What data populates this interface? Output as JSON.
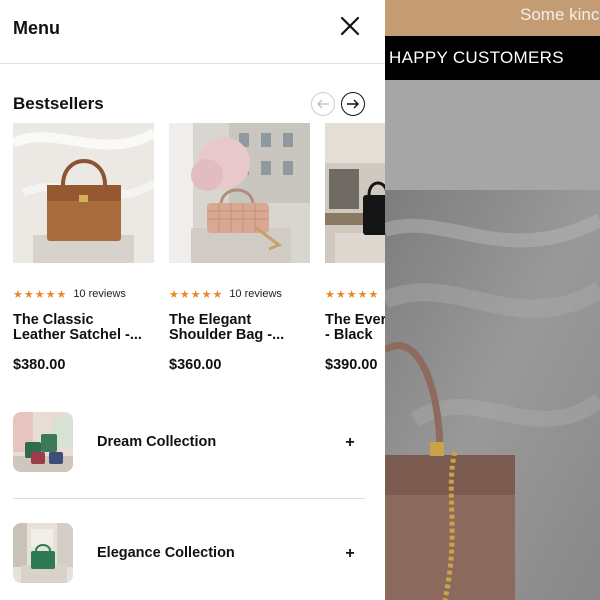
{
  "background_page": {
    "promo_text": "Some kinc",
    "customers_heading": "HAPPY CUSTOMERS"
  },
  "menu": {
    "title": "Menu",
    "close_icon": "close-icon"
  },
  "bestsellers": {
    "title": "Bestsellers",
    "prev_icon": "arrow-left-icon",
    "next_icon": "arrow-right-icon",
    "products": [
      {
        "name": "The Classic\nLeather Satchel -...",
        "price": "$380.00",
        "stars": "★★★★★",
        "reviews": "10 reviews"
      },
      {
        "name": "The Elegant\nShoulder Bag -...",
        "price": "$360.00",
        "stars": "★★★★★",
        "reviews": "10 reviews"
      },
      {
        "name": "The Ever\n- Black",
        "price": "$390.00",
        "stars": "★★★★★",
        "reviews": ""
      }
    ]
  },
  "collections": [
    {
      "label": "Dream Collection",
      "icon": "plus-icon"
    },
    {
      "label": "Elegance Collection",
      "icon": "plus-icon"
    }
  ],
  "colors": {
    "accent_star": "#e8892a",
    "promo_bar": "#c39c74",
    "customers_bar": "#000000"
  }
}
